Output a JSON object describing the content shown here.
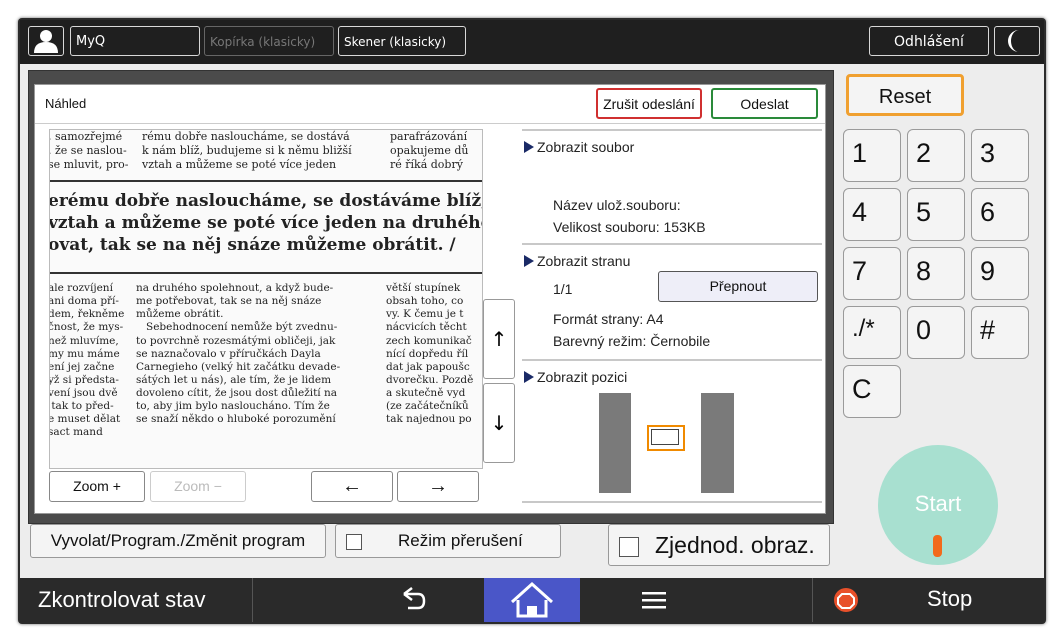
{
  "topbar": {
    "user_label": "MyQ",
    "copy_label": "Kopírka (klasicky)",
    "scan_label": "Skener (klasicky)",
    "logout_label": "Odhlášení"
  },
  "dialog": {
    "title": "Náhled",
    "cancel_label": "Zrušit odeslání",
    "send_label": "Odeslat",
    "zoom_in": "Zoom +",
    "zoom_out": "Zoom −",
    "show_file": "Zobrazit soubor",
    "file_name": "Název ulož.souboru:",
    "file_size": "Velikost souboru: 153KB",
    "show_page": "Zobrazit stranu",
    "page_count": "1/1",
    "switch_label": "Přepnout",
    "page_format": "Formát strany: A4",
    "color_mode": "Barevný režim: Černobile",
    "show_position": "Zobrazit pozici"
  },
  "document_text": {
    "top_col1": ", samozřejmé\n. že se naslou-\nse mluvit, pro-",
    "top_col2": "rému dobře nasloucháme, se dostává\nk nám blíž, budujeme si k němu bližší\nvztah a můžeme se poté více jeden",
    "top_col3": "parafrázování\nopakujeme dů\nré říká dobrý",
    "headline": "erému dobře nasloucháme, se dostáváme blíž, budu\nvztah a můžeme se poté více jeden na druhého spol\novat, tak se na něj snáze můžeme obrátit. /",
    "body_col1": "ale rozvíjení\nani doma pří-\ndem, řekněme\nčnost, že mys-\nnež mluvíme,\nmy mu máme\není jej začne\nyž si předsta-\nvení jsou dvě\n tak to před-\ne muset dělat\nsact mand",
    "body_col2": "na druhého spolehnout, a když bude-\nme potřebovat, tak se na něj snáze\nmůžeme obrátit.\n   Sebehodnocení nemůže být zvednu-\nto povrchně rozesmátými obličeji, jak\nse naznačovalo v příručkách Dayla\nCarnegieho (velký hit začátku devade-\nsátých let u nás), ale tím, že je lidem\ndovoleno cítit, že jsou dost důležití na\nto, aby jim bylo nasloucháno. Tím že\nse snaží někdo o hluboké porozumění",
    "body_col3": "větší stupínek\nobsah toho, co\nvy. K čemu je t\nnácvicích těcht\nzech komunikač\nnící dopředu říl\ndat jak papoušc\ndvorečku. Pozdě\na skutečně vyd\n(ze začátečníků\ntak najednou po"
  },
  "keypad": [
    "1",
    "2",
    "3",
    "4",
    "5",
    "6",
    "7",
    "8",
    "9",
    "./*",
    "0",
    "#",
    "C"
  ],
  "reset_label": "Reset",
  "start_label": "Start",
  "lower_buttons": {
    "program_label": "Vyvolat/Program./Změnit program",
    "interrupt_label": "Režim přerušení",
    "simplify_label": "Zjednod. obraz."
  },
  "bottombar": {
    "status_label": "Zkontrolovat stav",
    "stop_label": "Stop"
  },
  "colors": {
    "reset_border": "#f0a030",
    "cancel_border": "#d03030",
    "send_border": "#2a8a3a",
    "start_bg": "#a8e0d0",
    "home_bg": "#4a56c8",
    "stop_icon": "#e8502a",
    "position_frame": "#f08a00"
  }
}
